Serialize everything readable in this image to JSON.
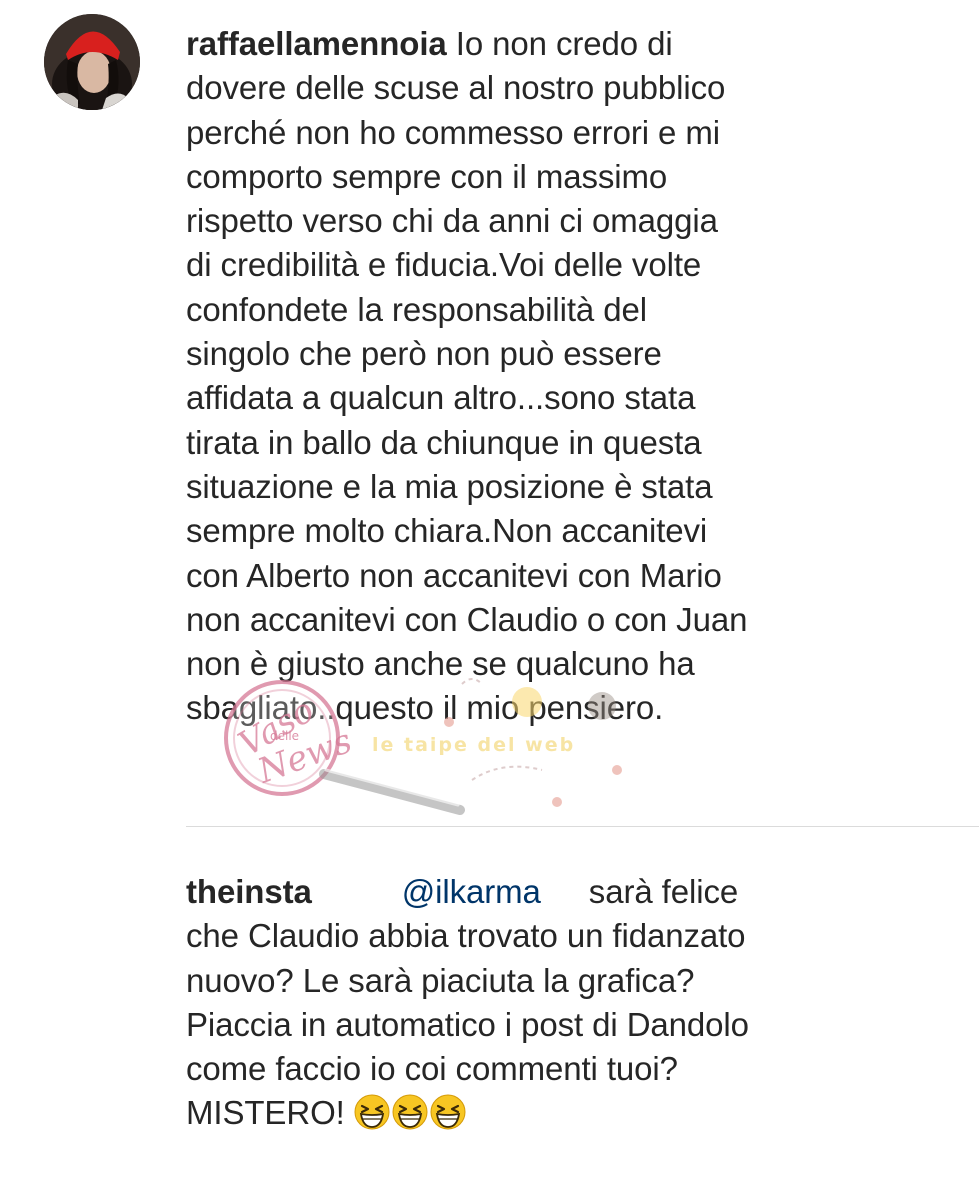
{
  "comments": [
    {
      "username": "raffaellamennoia",
      "text": "Io non credo di\ndovere delle scuse al nostro pubblico\nperché non ho commesso errori e mi\ncomporto sempre con il massimo\nrispetto verso chi da anni ci omaggia\ndi credibilità e fiducia.Voi delle volte\nconfondete la responsabilità del\nsingolo che però  non può essere\naffidata a qualcun altro...sono stata\ntirata in ballo da chiunque in questa\nsituazione e la mia posizione è stata\nsempre molto chiara.Non accanitevi\ncon Alberto non accanitevi con Mario\nnon accanitevi con Claudio o con Juan\nnon è giusto anche se qualcuno ha\nsbagliato..questo il mio pensiero."
    },
    {
      "username": "theinsta",
      "mention": "@ilkarma",
      "text_first": "sarà felice",
      "text": "che Claudio abbia trovato un fidanzato\nnuovo? Le sarà piaciuta la grafica?\nPiaccia in automatico i post di Dandolo\ncome faccio io coi commenti tuoi?\nMISTERO!"
    }
  ],
  "emojis": [
    "grinning-squinting-face",
    "grinning-squinting-face",
    "grinning-squinting-face"
  ],
  "watermark": {
    "lines": [
      "Vaso",
      "delle",
      "News"
    ],
    "secondary_text": "le taipe del web"
  },
  "colors": {
    "text": "#262626",
    "mention": "#003569",
    "divider": "#dbdbdb"
  }
}
